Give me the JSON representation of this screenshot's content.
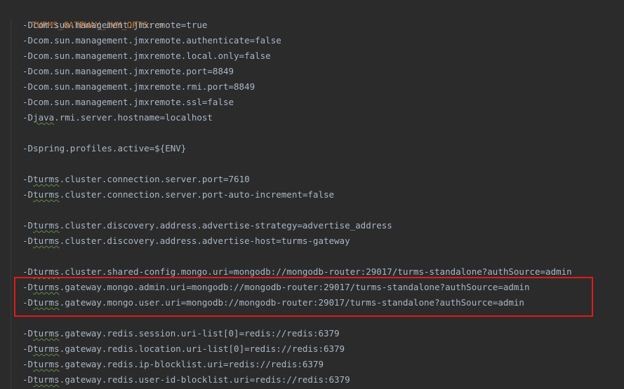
{
  "editor": {
    "key_name": "TURMS_GATEWAY_JVM_OPTS",
    "key_suffix": ": >",
    "lines": [
      {
        "prefix": "-Dcom.sun.management.jmxremote=true"
      },
      {
        "prefix": "-Dcom.sun.management.jmxremote.authenticate=false"
      },
      {
        "prefix": "-Dcom.sun.management.jmxremote.local.only=false"
      },
      {
        "prefix": "-Dcom.sun.management.jmxremote.port=8849"
      },
      {
        "prefix": "-Dcom.sun.management.jmxremote.rmi.port=8849"
      },
      {
        "prefix": "-Dcom.sun.management.jmxremote.ssl=false"
      },
      {
        "prefix": "-D",
        "squiggle": "java",
        "rest": ".rmi.server.hostname=localhost"
      },
      {
        "prefix": "-Dspring.profiles.active=${ENV}"
      },
      {
        "prefix": "-D",
        "squiggle": "turms",
        "rest": ".cluster.connection.server.port=7610"
      },
      {
        "prefix": "-D",
        "squiggle": "turms",
        "rest": ".cluster.connection.server.port-auto-increment=false"
      },
      {
        "prefix": "-D",
        "squiggle": "turms",
        "rest": ".cluster.discovery.address.advertise-strategy=advertise_address"
      },
      {
        "prefix": "-D",
        "squiggle": "turms",
        "rest": ".cluster.discovery.address.advertise-host=turms-gateway"
      },
      {
        "prefix": "-D",
        "squiggle": "turms",
        "rest": ".cluster.shared-config.mongo.uri=mongodb://mongodb-router:29017/turms-standalone?authSource=admin"
      },
      {
        "prefix": "-D",
        "squiggle": "turms",
        "rest": ".gateway.mongo.admin.uri=mongodb://mongodb-router:29017/turms-standalone?authSource=admin"
      },
      {
        "prefix": "-D",
        "squiggle": "turms",
        "rest": ".gateway.mongo.user.uri=mongodb://mongodb-router:29017/turms-standalone?authSource=admin"
      },
      {
        "prefix": "-D",
        "squiggle": "turms",
        "rest": ".gateway.redis.session.uri-list[0]=redis://redis:6379"
      },
      {
        "prefix": "-D",
        "squiggle": "turms",
        "rest": ".gateway.redis.location.uri-list[0]=redis://redis:6379"
      },
      {
        "prefix": "-D",
        "squiggle": "turms",
        "rest": ".gateway.redis.ip-blocklist.uri=redis://redis:6379"
      },
      {
        "prefix": "-D",
        "squiggle": "turms",
        "rest": ".gateway.redis.user-id-blocklist.uri=redis://redis:6379"
      }
    ]
  },
  "colors": {
    "background": "#2b2b2b",
    "text": "#a9b7c6",
    "key": "#cc7832",
    "highlight_border": "#e21a1a",
    "spellcheck_underline": "#5f8c43"
  }
}
